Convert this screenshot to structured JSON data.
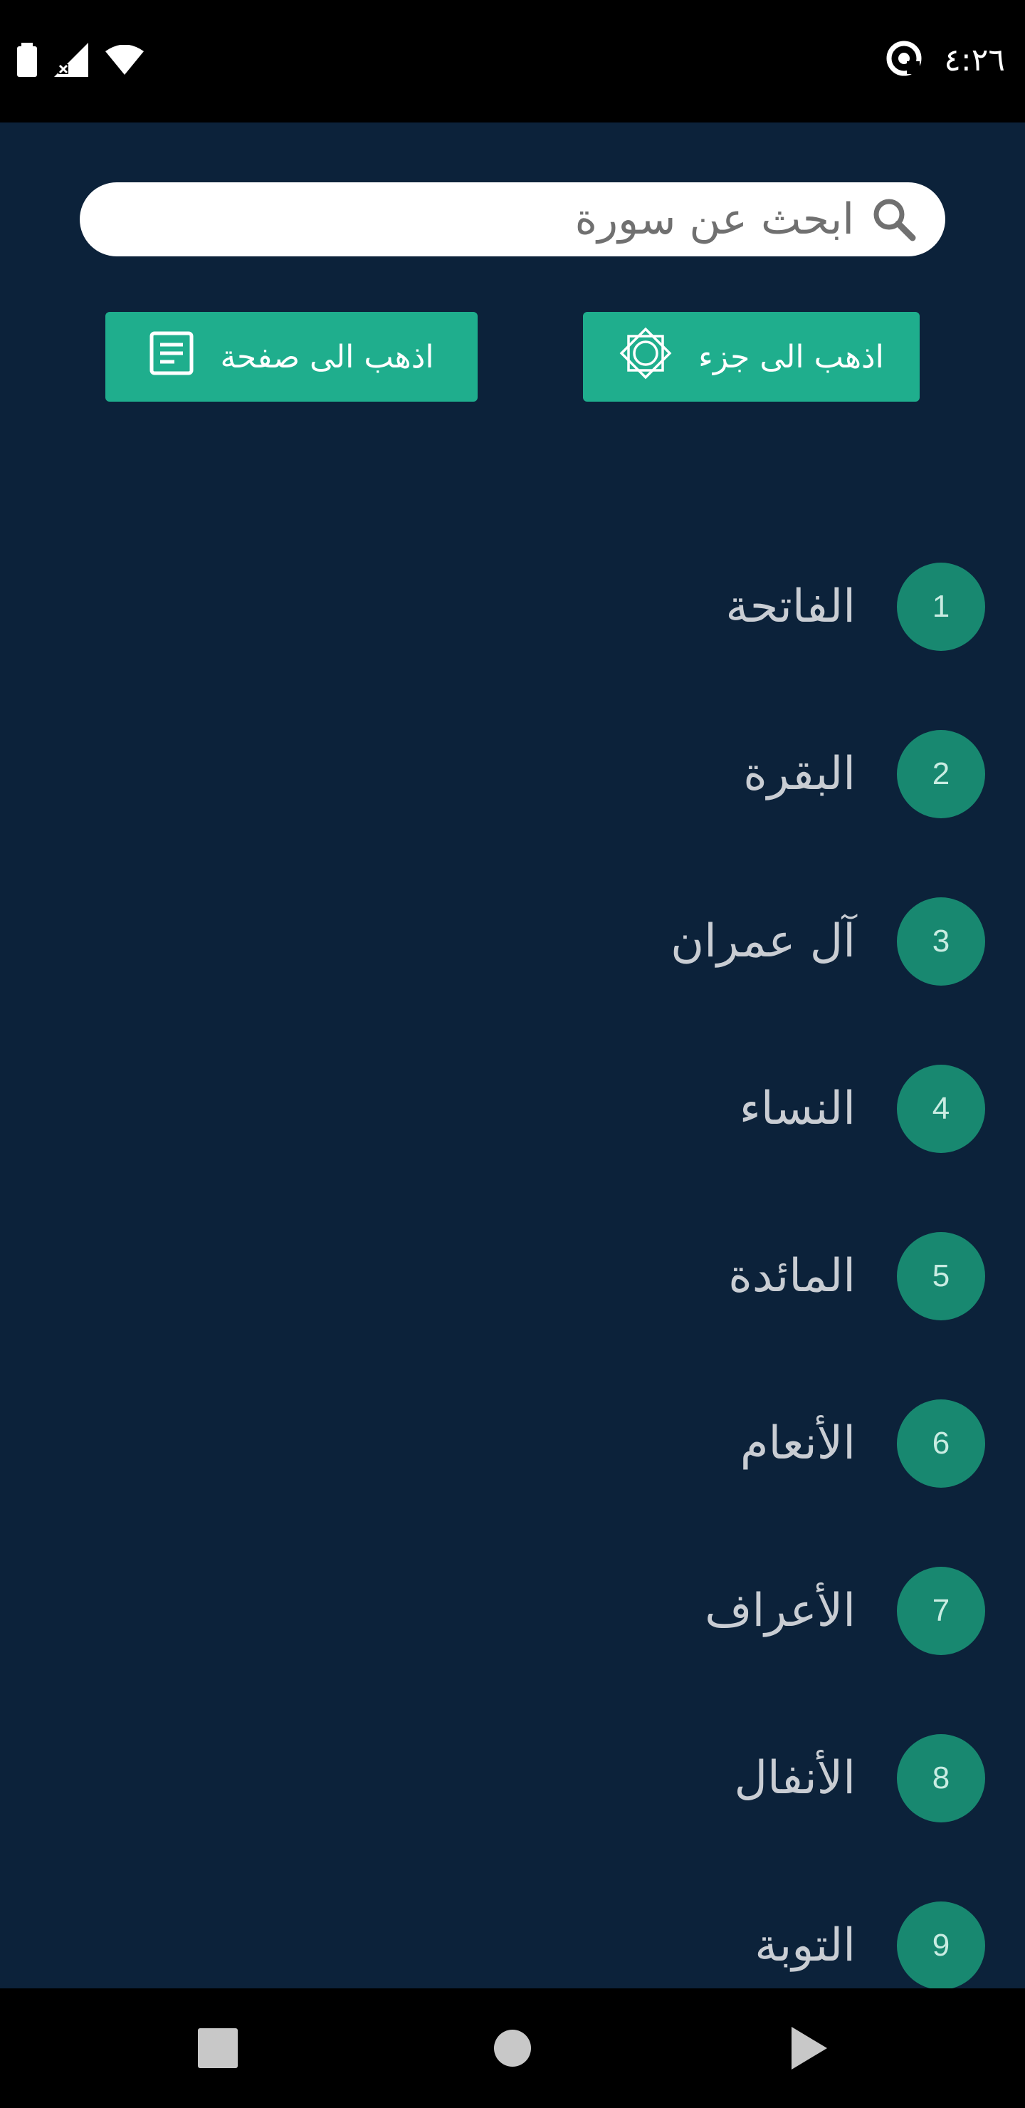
{
  "status_bar": {
    "time": "٤:٢٦",
    "icons": [
      "battery-icon",
      "signal-off-icon",
      "wifi-icon",
      "data-saver-icon"
    ]
  },
  "search": {
    "placeholder": "ابحث عن سورة",
    "icon": "search-icon"
  },
  "actions": {
    "go_to_juz_label": "اذهب الى جزء",
    "go_to_juz_icon": "star-octagram-icon",
    "go_to_page_label": "اذهب الى صفحة",
    "go_to_page_icon": "page-icon"
  },
  "surahs": [
    {
      "number": "1",
      "name": "الفاتحة"
    },
    {
      "number": "2",
      "name": "البقرة"
    },
    {
      "number": "3",
      "name": "آل عمران"
    },
    {
      "number": "4",
      "name": "النساء"
    },
    {
      "number": "5",
      "name": "المائدة"
    },
    {
      "number": "6",
      "name": "الأنعام"
    },
    {
      "number": "7",
      "name": "الأعراف"
    },
    {
      "number": "8",
      "name": "الأنفال"
    },
    {
      "number": "9",
      "name": "التوبة"
    }
  ],
  "nav_bar": {
    "buttons": [
      "recents-icon",
      "home-icon",
      "back-icon"
    ]
  },
  "colors": {
    "background": "#0c223a",
    "accent": "#1fae8d",
    "badge": "#188870"
  }
}
